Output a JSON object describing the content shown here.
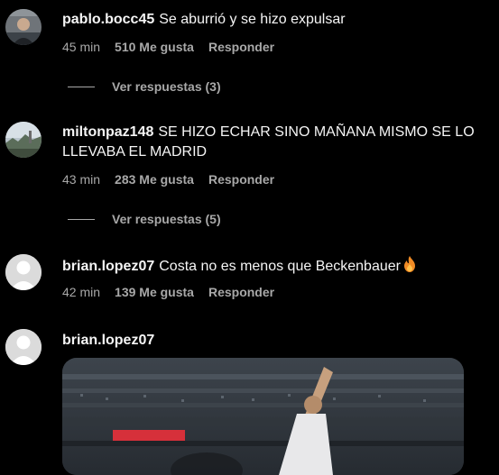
{
  "comments": [
    {
      "username": "pablo.bocc45",
      "text": "Se aburrió y se hizo expulsar",
      "time": "45 min",
      "likes": "510 Me gusta",
      "reply_label": "Responder",
      "view_replies": "Ver respuestas (3)",
      "avatar_icon": "user-photo-avatar"
    },
    {
      "username": "miltonpaz148",
      "text": "SE HIZO ECHAR SINO MAÑANA MISMO SE LO LLEVABA EL MADRID",
      "time": "43 min",
      "likes": "283 Me gusta",
      "reply_label": "Responder",
      "view_replies": "Ver respuestas (5)",
      "avatar_icon": "landscape-photo-avatar"
    },
    {
      "username": "brian.lopez07",
      "text": "Costa no es menos que Beckenbauer",
      "emoji_icon": "fire-icon",
      "time": "42 min",
      "likes": "139 Me gusta",
      "reply_label": "Responder",
      "avatar_icon": "default-avatar"
    },
    {
      "username": "brian.lopez07",
      "media_icon": "stadium-photo",
      "avatar_icon": "default-avatar"
    }
  ],
  "colors": {
    "background": "#000000",
    "text": "#f5f5f5",
    "secondary_text": "#a8a8a8",
    "fire": "#f08a24"
  }
}
